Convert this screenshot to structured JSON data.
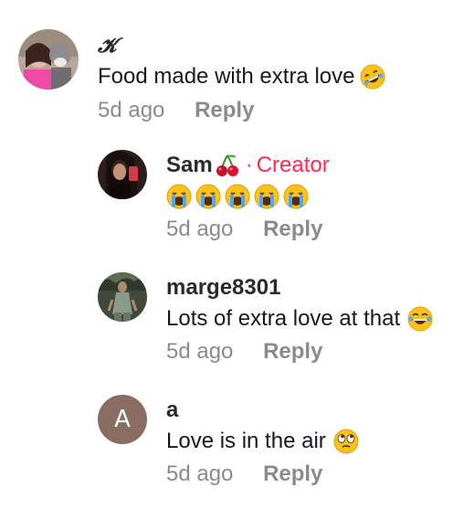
{
  "comments": [
    {
      "username": "𝓚",
      "text": "Food made with extra love",
      "emoji": "rofl-emoji",
      "time": "5d ago",
      "reply": "Reply"
    },
    {
      "username": "Sam",
      "username_emoji": "cherries-emoji",
      "separator": "·",
      "badge": "Creator",
      "emojis": [
        "crying-emoji",
        "crying-emoji",
        "crying-emoji",
        "crying-emoji",
        "crying-emoji"
      ],
      "time": "5d ago",
      "reply": "Reply"
    },
    {
      "username": "marge8301",
      "text": "Lots of extra love at that",
      "emoji": "laughing-tears-emoji",
      "time": "5d ago",
      "reply": "Reply"
    },
    {
      "username": "a",
      "avatar_letter": "A",
      "text": "Love is in the air",
      "emoji": "eye-roll-emoji",
      "time": "5d ago",
      "reply": "Reply"
    }
  ],
  "colors": {
    "creator": "#fe2c55",
    "meta": "#8a8b91",
    "avatar_letter_bg": "#8a6d62"
  }
}
